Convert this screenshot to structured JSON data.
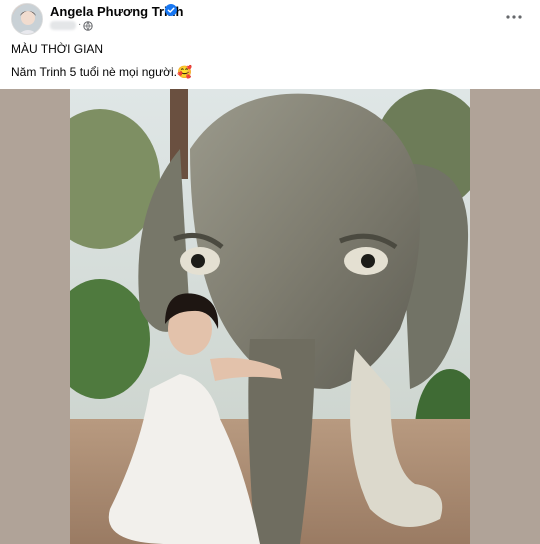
{
  "post": {
    "author": "Angela Phương Trinh",
    "title": "MÀU THỜI GIAN",
    "caption": "Năm Trinh 5 tuổi nè mọi người.🥰",
    "more_label": "•••"
  },
  "icons": {
    "verified": "verified-badge-icon",
    "privacy": "globe-icon",
    "more": "more-options-icon"
  },
  "colors": {
    "verified_blue": "#1877f2",
    "photo_backdrop": "#b0a398",
    "text_primary": "#050505",
    "text_secondary": "#65676b"
  }
}
